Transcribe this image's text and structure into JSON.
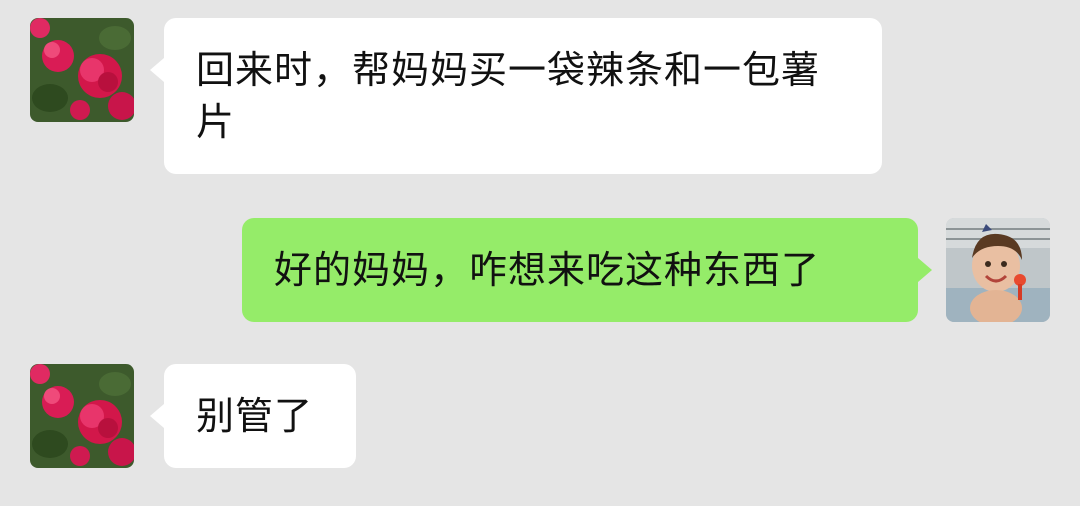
{
  "conversation": {
    "messages": [
      {
        "sender": "incoming",
        "avatar_icon": "rose-flower-avatar",
        "text": "回来时，帮妈妈买一袋辣条和一包薯片"
      },
      {
        "sender": "outgoing",
        "avatar_icon": "child-photo-avatar",
        "text": "好的妈妈，咋想来吃这种东西了"
      },
      {
        "sender": "incoming",
        "avatar_icon": "rose-flower-avatar",
        "text": "别管了"
      }
    ]
  },
  "colors": {
    "background": "#e5e5e5",
    "incoming_bubble": "#ffffff",
    "outgoing_bubble": "#95ec69",
    "text": "#111111"
  }
}
